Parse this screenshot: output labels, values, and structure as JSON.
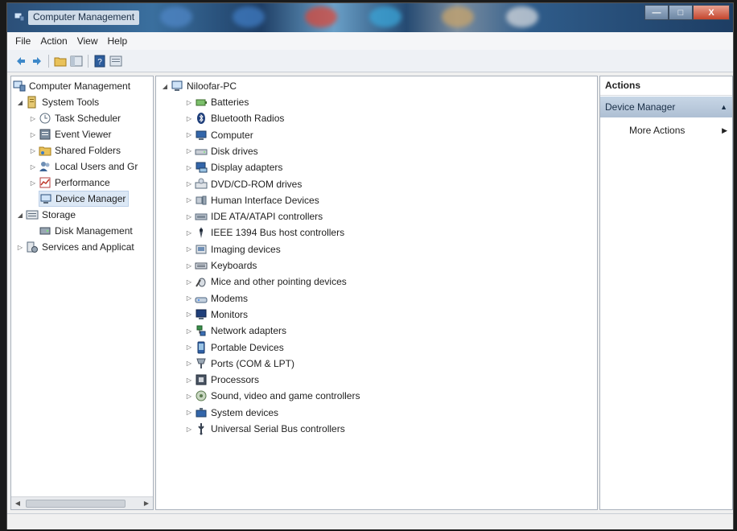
{
  "window": {
    "title": "Computer Management",
    "buttons": {
      "minimize": "—",
      "maximize": "□",
      "close": "X"
    }
  },
  "menu": [
    "File",
    "Action",
    "View",
    "Help"
  ],
  "left_tree": [
    {
      "label": "Computer Management",
      "icon": "computer-management-icon",
      "twisty": ""
    },
    {
      "label": "System Tools",
      "icon": "system-tools-icon",
      "twisty": "◢"
    },
    {
      "label": "Task Scheduler",
      "icon": "clock-icon",
      "twisty": "▷"
    },
    {
      "label": "Event Viewer",
      "icon": "event-viewer-icon",
      "twisty": "▷"
    },
    {
      "label": "Shared Folders",
      "icon": "shared-folder-icon",
      "twisty": "▷"
    },
    {
      "label": "Local Users and Gr",
      "icon": "users-icon",
      "twisty": "▷"
    },
    {
      "label": "Performance",
      "icon": "performance-icon",
      "twisty": "▷"
    },
    {
      "label": "Device Manager",
      "icon": "device-manager-icon",
      "twisty": ""
    },
    {
      "label": "Storage",
      "icon": "storage-icon",
      "twisty": "◢"
    },
    {
      "label": "Disk Management",
      "icon": "disk-management-icon",
      "twisty": ""
    },
    {
      "label": "Services and Applicat",
      "icon": "services-icon",
      "twisty": "▷"
    }
  ],
  "devices": {
    "root": "Niloofar-PC",
    "items": [
      {
        "label": "Batteries",
        "icon": "battery-icon"
      },
      {
        "label": "Bluetooth Radios",
        "icon": "bluetooth-icon"
      },
      {
        "label": "Computer",
        "icon": "computer-icon"
      },
      {
        "label": "Disk drives",
        "icon": "disk-drive-icon"
      },
      {
        "label": "Display adapters",
        "icon": "display-adapter-icon"
      },
      {
        "label": "DVD/CD-ROM drives",
        "icon": "dvd-drive-icon"
      },
      {
        "label": "Human Interface Devices",
        "icon": "hid-icon"
      },
      {
        "label": "IDE ATA/ATAPI controllers",
        "icon": "ide-controller-icon"
      },
      {
        "label": "IEEE 1394 Bus host controllers",
        "icon": "ieee1394-icon"
      },
      {
        "label": "Imaging devices",
        "icon": "imaging-device-icon"
      },
      {
        "label": "Keyboards",
        "icon": "keyboard-icon"
      },
      {
        "label": "Mice and other pointing devices",
        "icon": "mouse-icon"
      },
      {
        "label": "Modems",
        "icon": "modem-icon"
      },
      {
        "label": "Monitors",
        "icon": "monitor-icon"
      },
      {
        "label": "Network adapters",
        "icon": "network-adapter-icon"
      },
      {
        "label": "Portable Devices",
        "icon": "portable-device-icon"
      },
      {
        "label": "Ports (COM & LPT)",
        "icon": "port-icon"
      },
      {
        "label": "Processors",
        "icon": "processor-icon"
      },
      {
        "label": "Sound, video and game controllers",
        "icon": "sound-icon"
      },
      {
        "label": "System devices",
        "icon": "system-device-icon"
      },
      {
        "label": "Universal Serial Bus controllers",
        "icon": "usb-icon"
      }
    ]
  },
  "actions": {
    "title": "Actions",
    "group": "Device Manager",
    "group_arrow": "▲",
    "item": "More Actions",
    "item_arrow": "▶"
  },
  "colors": {
    "selection": "#dce8f5",
    "actions_header": "#b9cadc"
  }
}
